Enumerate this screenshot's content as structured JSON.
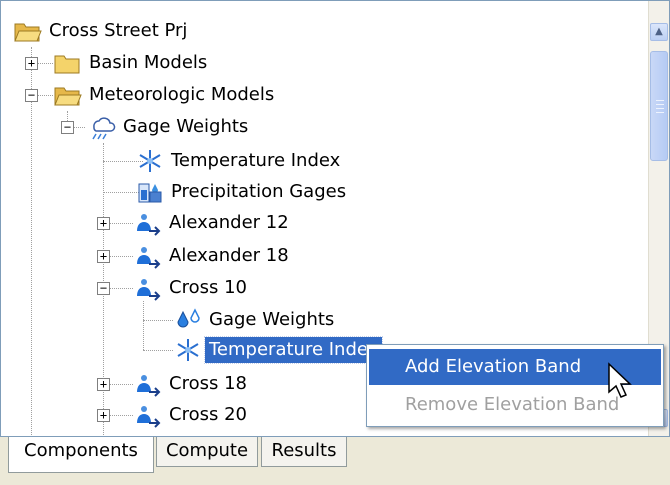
{
  "tree": {
    "root": "Cross Street Prj",
    "basin_models": "Basin Models",
    "meteorologic_models": "Meteorologic Models",
    "met_gage_weights": "Gage Weights",
    "temperature_index": "Temperature Index",
    "precipitation_gages": "Precipitation Gages",
    "alexander_12": "Alexander 12",
    "alexander_18": "Alexander 18",
    "cross_10": "Cross 10",
    "cross_10_gage_weights": "Gage Weights",
    "cross_10_temperature_index": "Temperature Index",
    "cross_18": "Cross 18",
    "cross_20": "Cross 20"
  },
  "context_menu": {
    "add_elevation_band": "Add Elevation Band",
    "remove_elevation_band": "Remove Elevation Band"
  },
  "tabs": {
    "components": "Components",
    "compute": "Compute",
    "results": "Results"
  },
  "colors": {
    "selection": "#316ac5",
    "folder": "#f4d36a",
    "subbasin": "#1f6fd8"
  }
}
